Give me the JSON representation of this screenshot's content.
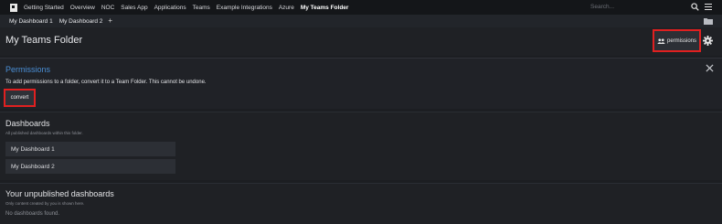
{
  "nav": {
    "items": [
      {
        "label": "Getting Started"
      },
      {
        "label": "Overview"
      },
      {
        "label": "NOC"
      },
      {
        "label": "Sales App"
      },
      {
        "label": "Applications"
      },
      {
        "label": "Teams"
      },
      {
        "label": "Example Integrations"
      },
      {
        "label": "Azure"
      },
      {
        "label": "My Teams Folder"
      }
    ],
    "active_item": "My Teams Folder",
    "search_placeholder": "Search..."
  },
  "tabs": {
    "items": [
      {
        "label": "My Dashboard 1"
      },
      {
        "label": "My Dashboard 2"
      }
    ],
    "add_label": "+"
  },
  "header": {
    "title": "My Teams Folder",
    "permissions_label": "permissions"
  },
  "permissions_panel": {
    "title": "Permissions",
    "description": "To add permissions to a folder, convert it to a Team Folder. This cannot be undone.",
    "convert_label": "convert"
  },
  "dashboards": {
    "title": "Dashboards",
    "subtitle": "All published dashboards within this folder.",
    "items": [
      {
        "label": "My Dashboard 1"
      },
      {
        "label": "My Dashboard 2"
      }
    ]
  },
  "unpublished": {
    "title": "Your unpublished dashboards",
    "subtitle": "Only content created by you is shown here.",
    "empty_text": "No dashboards found."
  },
  "colors": {
    "accent_blue": "#4a8fd6",
    "highlight_red": "#e02020",
    "background": "#1c1e22"
  },
  "icons": [
    "app-logo-icon",
    "search-icon",
    "menu-icon",
    "folder-icon",
    "users-icon",
    "gear-icon",
    "close-icon"
  ]
}
